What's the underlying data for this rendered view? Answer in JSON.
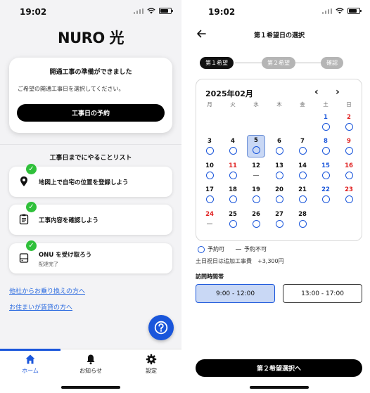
{
  "left": {
    "status_time": "19:02",
    "logo": "NURO 光",
    "card": {
      "title": "開通工事の準備ができました",
      "description": "ご希望の開通工事日を選択してください。",
      "button": "工事日の予約"
    },
    "todo_title": "工事日までにやることリスト",
    "tasks": [
      {
        "label": "地図上で自宅の位置を登録しよう",
        "sub": "",
        "icon": "map-pin-icon"
      },
      {
        "label": "工事内容を確認しよう",
        "sub": "",
        "icon": "document-icon"
      },
      {
        "label": "ONU を受け取ろう",
        "sub": "配達完了",
        "icon": "device-icon"
      }
    ],
    "links": [
      "他社からお乗り換えの方へ",
      "お住まいが賃貸の方へ"
    ],
    "tabs": [
      {
        "label": "ホーム",
        "icon": "home-icon"
      },
      {
        "label": "お知らせ",
        "icon": "bell-icon"
      },
      {
        "label": "設定",
        "icon": "gear-icon"
      }
    ]
  },
  "right": {
    "status_time": "19:02",
    "title": "第１希望日の選択",
    "steps": [
      "第１希望",
      "第２希望",
      "確認"
    ],
    "month_label": "2025年02月",
    "weekdays": [
      "月",
      "火",
      "水",
      "木",
      "金",
      "土",
      "日"
    ],
    "days": [
      {
        "n": "1",
        "s": "o",
        "c": "sat"
      },
      {
        "n": "2",
        "s": "o",
        "c": "sun"
      },
      {
        "n": "3",
        "s": "o",
        "c": ""
      },
      {
        "n": "4",
        "s": "o",
        "c": ""
      },
      {
        "n": "5",
        "s": "o",
        "c": "",
        "selected": true
      },
      {
        "n": "6",
        "s": "o",
        "c": ""
      },
      {
        "n": "7",
        "s": "o",
        "c": ""
      },
      {
        "n": "8",
        "s": "o",
        "c": "sat"
      },
      {
        "n": "9",
        "s": "o",
        "c": "sun"
      },
      {
        "n": "10",
        "s": "o",
        "c": ""
      },
      {
        "n": "11",
        "s": "o",
        "c": "hol"
      },
      {
        "n": "12",
        "s": "-",
        "c": ""
      },
      {
        "n": "13",
        "s": "o",
        "c": ""
      },
      {
        "n": "14",
        "s": "o",
        "c": ""
      },
      {
        "n": "15",
        "s": "o",
        "c": "sat"
      },
      {
        "n": "16",
        "s": "o",
        "c": "sun"
      },
      {
        "n": "17",
        "s": "o",
        "c": ""
      },
      {
        "n": "18",
        "s": "o",
        "c": ""
      },
      {
        "n": "19",
        "s": "o",
        "c": ""
      },
      {
        "n": "20",
        "s": "o",
        "c": ""
      },
      {
        "n": "21",
        "s": "o",
        "c": ""
      },
      {
        "n": "22",
        "s": "o",
        "c": "sat"
      },
      {
        "n": "23",
        "s": "o",
        "c": "sun"
      },
      {
        "n": "24",
        "s": "-",
        "c": "hol"
      },
      {
        "n": "25",
        "s": "o",
        "c": ""
      },
      {
        "n": "26",
        "s": "o",
        "c": ""
      },
      {
        "n": "27",
        "s": "o",
        "c": ""
      },
      {
        "n": "28",
        "s": "o",
        "c": ""
      }
    ],
    "legend_available": "予約可",
    "legend_unavailable": "予約不可",
    "note": "土日祝日は追加工事費　+3,300円",
    "time_title": "訪問時間帯",
    "time_slots": [
      "9:00 - 12:00",
      "13:00 - 17:00"
    ],
    "next_button": "第２希望選択へ"
  },
  "colors": {
    "accent": "#1a56db",
    "check": "#2fc03a",
    "sat": "#1a56db",
    "sun": "#e02020"
  }
}
